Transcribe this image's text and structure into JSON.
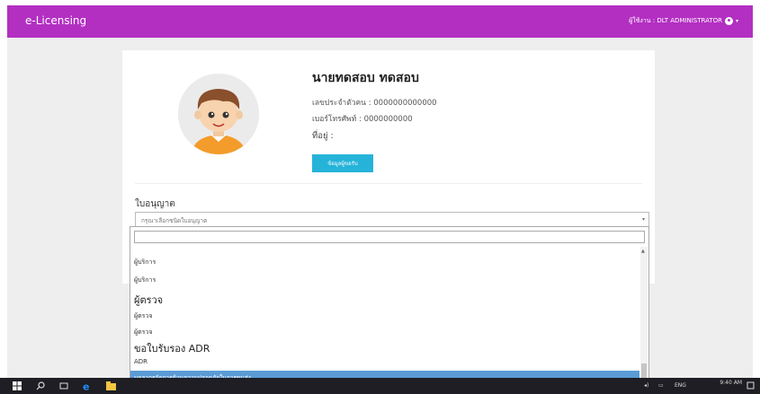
{
  "app": {
    "brand": "e-Licensing"
  },
  "user": {
    "label": "ผู้ใช้งาน : DLT ADMINISTRATOR",
    "caret": "▾"
  },
  "profile": {
    "name": "นายทดสอบ ทดสอบ",
    "id_line": "เลขประจำตัวคน : 0000000000000",
    "phone_line": "เบอร์โทรศัพท์ : 0000000000",
    "address_line": "ที่อยู่ :",
    "button_label": "ข้อมูลผู้ขอรับ"
  },
  "license": {
    "section_label": "ใบอนุญาต",
    "select_placeholder": "กรุณาเลือกชนิดใบอนุญาต",
    "arrow": "▾"
  },
  "dropdown": {
    "options": [
      "ผู้บริการ",
      "ผู้บริการ",
      "ผู้ตรวจ",
      "ผู้ตรวจ",
      "ผู้ตรวจ",
      "ขอใบรับรอง ADR",
      "ADR",
      "บุคลากรจัดการด้านความปลอดภัยในการขนส่ง"
    ]
  },
  "taskbar": {
    "lang": "ENG",
    "time": "9:40 AM"
  },
  "colors": {
    "topbar": "#b32fc2",
    "button": "#26b3d9",
    "highlight": "#5b9bd5"
  }
}
